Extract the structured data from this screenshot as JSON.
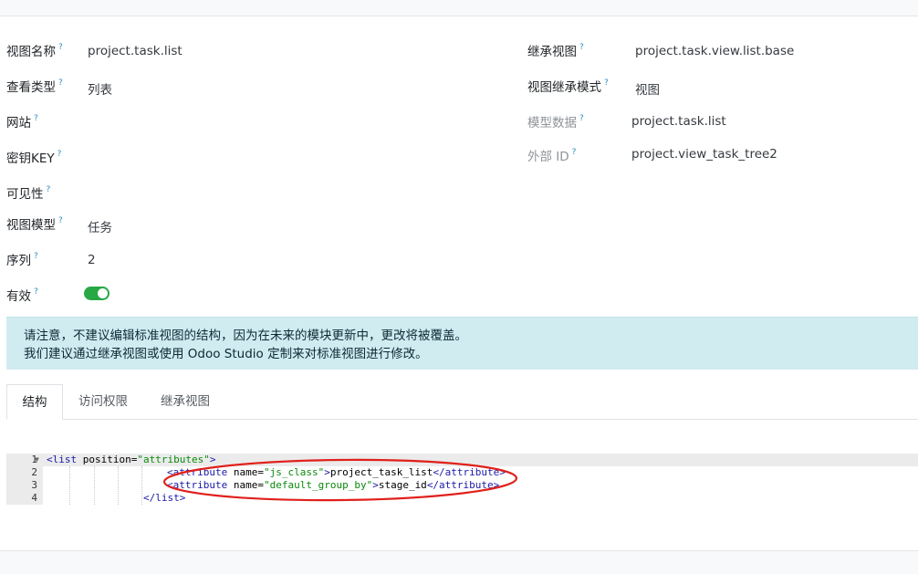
{
  "form": {
    "left": [
      {
        "label": "视图名称",
        "value": "project.task.list"
      },
      {
        "label": "查看类型",
        "value": "列表"
      },
      {
        "label": "网站",
        "value": ""
      },
      {
        "label": "密钥KEY",
        "value": ""
      },
      {
        "label": "可见性",
        "value": ""
      },
      {
        "label": "视图模型",
        "value": "任务"
      },
      {
        "label": "序列",
        "value": "2"
      },
      {
        "label": "有效",
        "value": ""
      }
    ],
    "right": [
      {
        "label": "继承视图",
        "value": "project.task.view.list.base"
      },
      {
        "label": "视图继承模式",
        "value": "视图"
      },
      {
        "label": "模型数据",
        "value": "project.task.list"
      },
      {
        "label": "外部 ID",
        "value": "project.view_task_tree2"
      }
    ],
    "help_mark": "?"
  },
  "active_toggle": {
    "on": true,
    "color": "#28a745"
  },
  "alert": {
    "line1": "请注意，不建议编辑标准视图的结构，因为在未来的模块更新中，更改将被覆盖。",
    "line2": "我们建议通过继承视图或使用 Odoo Studio 定制来对标准视图进行修改。"
  },
  "tabs": [
    "结构",
    "访问权限",
    "继承视图"
  ],
  "editor": {
    "line_numbers": [
      "1",
      "2",
      "3",
      "4"
    ],
    "fold_icon": "caret-down-icon",
    "lines": [
      {
        "tag_open": "<list",
        "attr": " position=",
        "str": "\"attributes\"",
        "tail": ">",
        "text": "",
        "close": ""
      },
      {
        "tag_open": "<attribute",
        "attr": " name=",
        "str": "\"js_class\"",
        "tail": ">",
        "text": "project_task_list",
        "close": "</attribute>"
      },
      {
        "tag_open": "<attribute",
        "attr": " name=",
        "str": "\"default_group_by\"",
        "tail": ">",
        "text": "stage_id",
        "close": "</attribute>"
      },
      {
        "tag_open": "</list>",
        "attr": "",
        "str": "",
        "tail": "",
        "text": "",
        "close": ""
      }
    ]
  },
  "colors": {
    "help": "#2a8fbd",
    "alert_bg": "#d1ecf1",
    "annotation": "#e0201b"
  }
}
